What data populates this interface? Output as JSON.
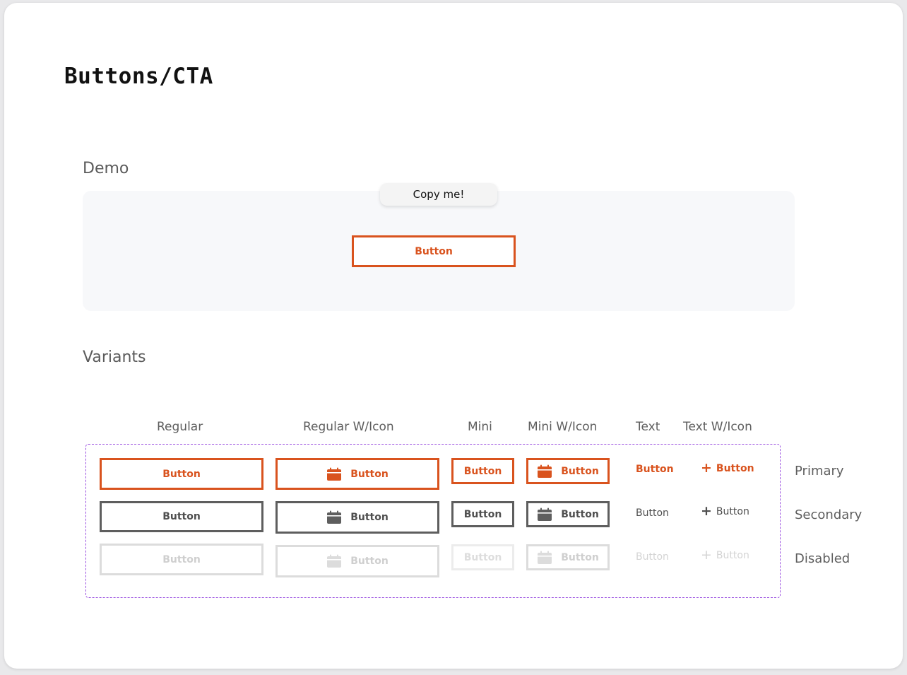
{
  "page": {
    "title": "Buttons/CTA"
  },
  "demo": {
    "heading": "Demo",
    "copy_label": "Copy me!",
    "button_label": "Button"
  },
  "variants": {
    "heading": "Variants",
    "columns": [
      "Regular",
      "Regular W/Icon",
      "Mini",
      "Mini W/Icon",
      "Text",
      "Text W/Icon"
    ],
    "rows": [
      "Primary",
      "Secondary",
      "Disabled"
    ],
    "button_label": "Button",
    "icons": {
      "with_icon_buttons": "calendar-icon",
      "text_with_icon": "plus-icon"
    }
  },
  "colors": {
    "primary": "#d9531e",
    "secondary": "#5e5e5e",
    "disabled": "#dcdcdc",
    "frame": "#9b51e0"
  }
}
